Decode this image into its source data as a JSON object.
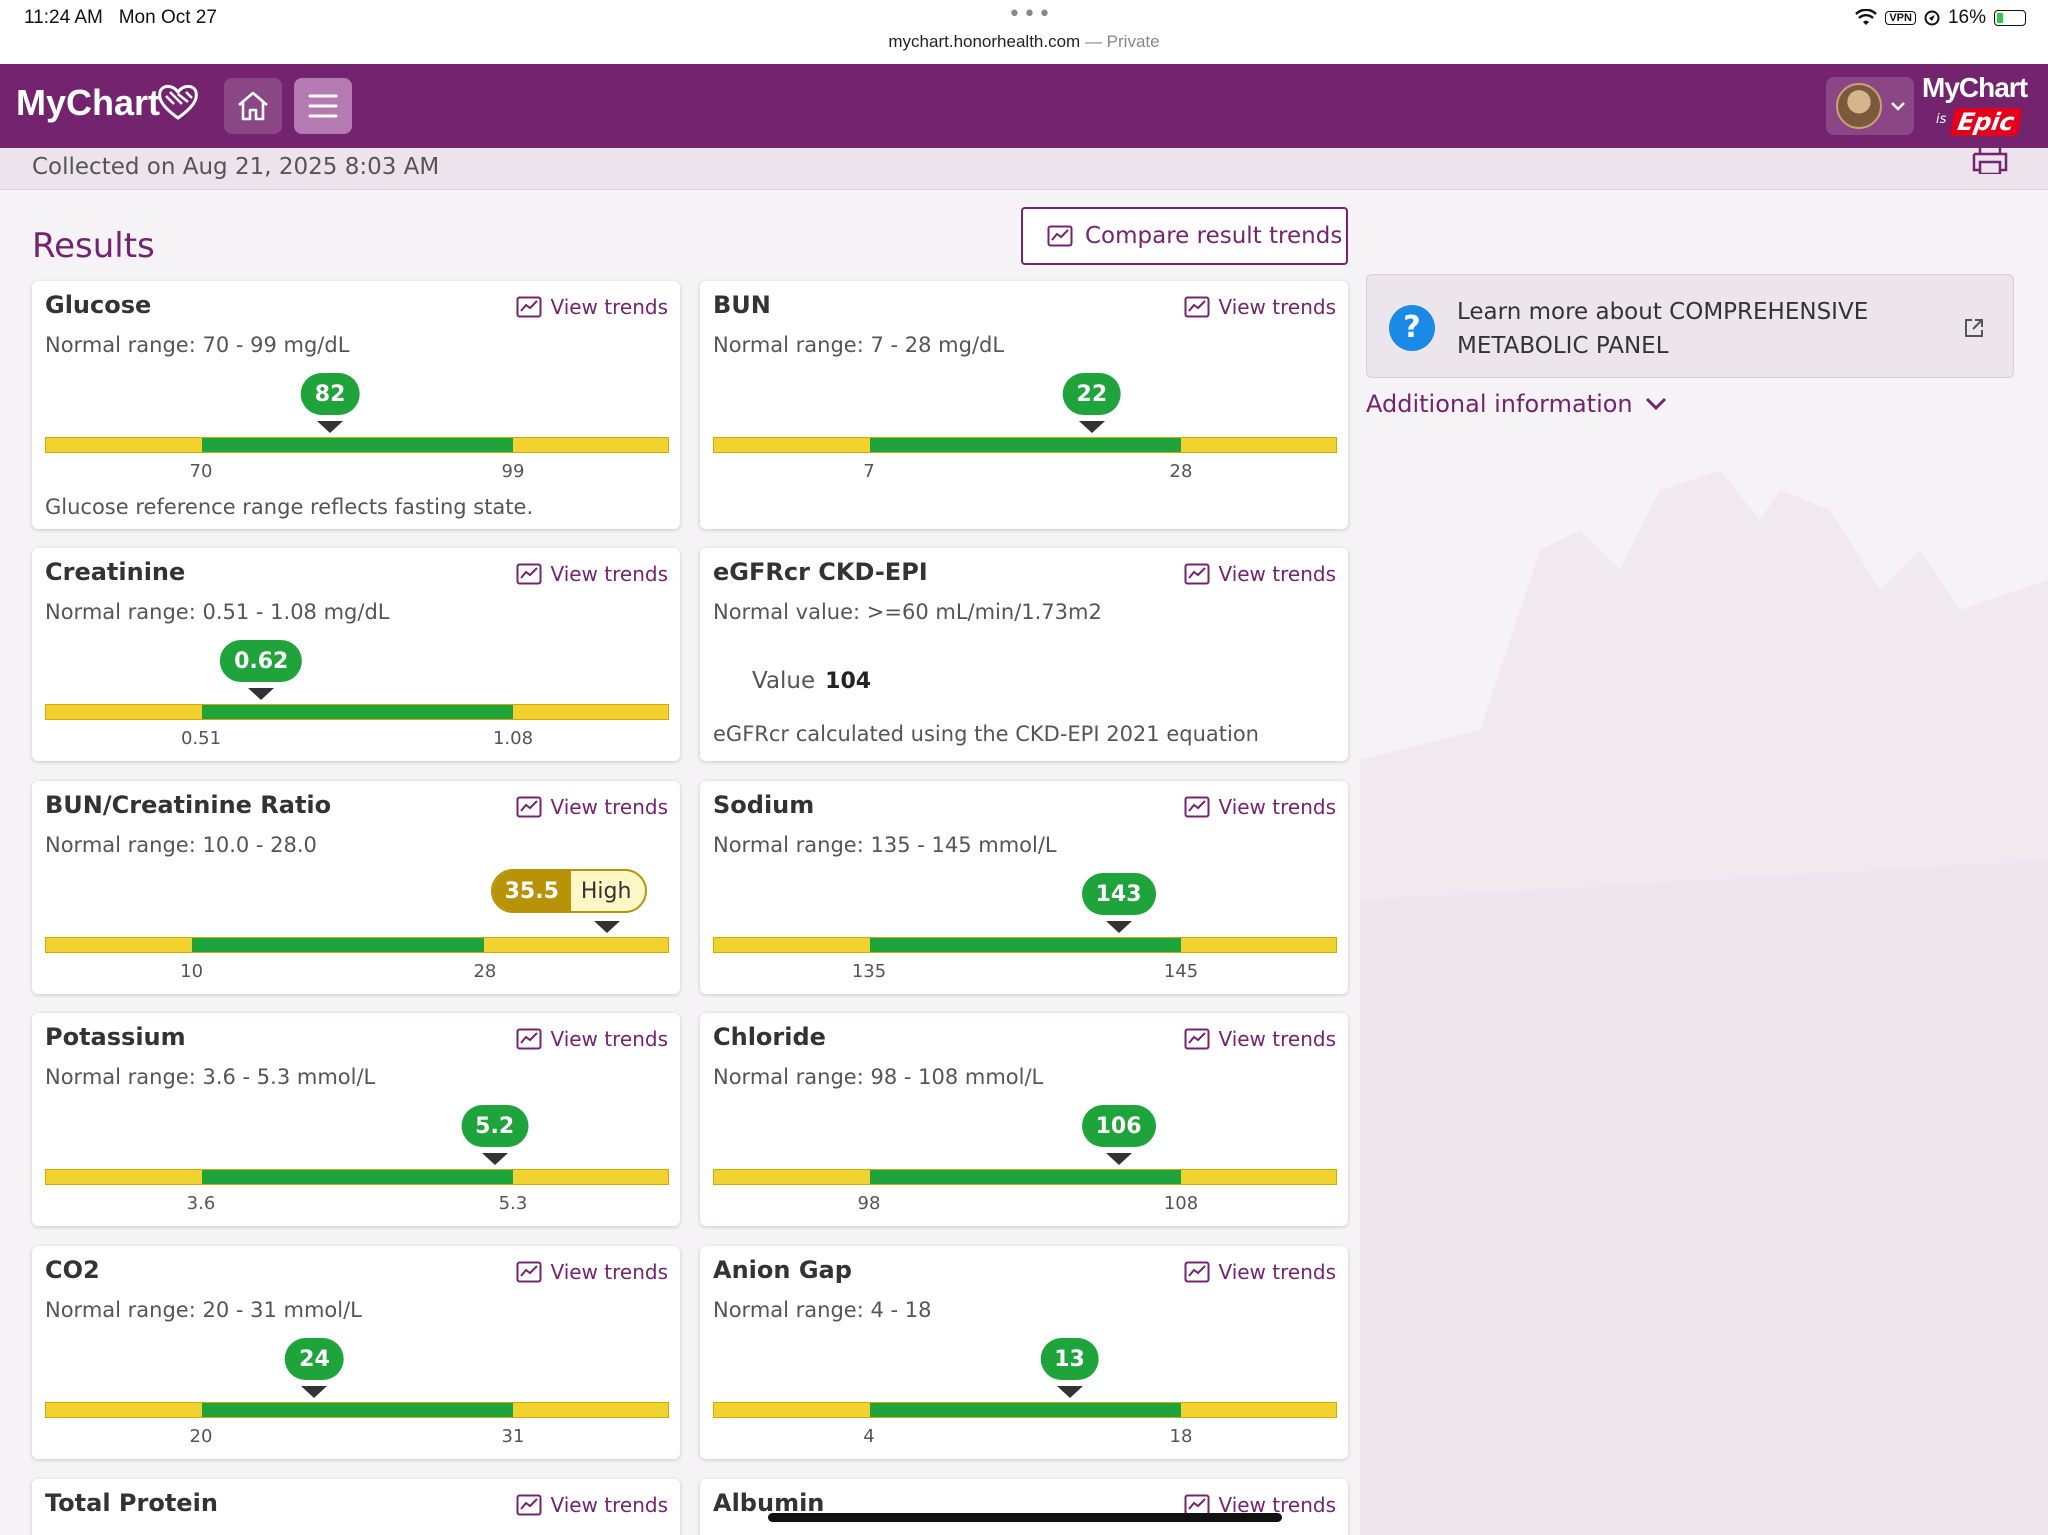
{
  "status": {
    "time": "11:24 AM",
    "date": "Mon Oct 27",
    "url": "mychart.honorhealth.com",
    "private": "— Private",
    "vpn": "VPN",
    "battery": "16%"
  },
  "header": {
    "logo_text": "MyChart",
    "epic_mychart": "MyChart",
    "epic_is": "is",
    "epic_brand": "Epic"
  },
  "collected": "Collected on Aug 21, 2025 8:03 AM",
  "results_title": "Results",
  "compare_label": "Compare result trends",
  "view_trends": "View trends",
  "learn_more": "Learn more about COMPREHENSIVE METABOLIC PANEL",
  "additional_info": "Additional information",
  "results": [
    {
      "name": "Glucose",
      "range_text": "Normal range: 70 - 99 mg/dL",
      "value": "82",
      "low": "70",
      "high": "99",
      "note": "Glucose reference range reflects fasting state."
    },
    {
      "name": "BUN",
      "range_text": "Normal range: 7 - 28 mg/dL",
      "value": "22",
      "low": "7",
      "high": "28"
    },
    {
      "name": "Creatinine",
      "range_text": "Normal range: 0.51 - 1.08 mg/dL",
      "value": "0.62",
      "low": "0.51",
      "high": "1.08"
    },
    {
      "name": "eGFRcr CKD-EPI",
      "range_text": "Normal value: >=60 mL/min/1.73m2",
      "value_label": "Value",
      "value": "104",
      "note": "eGFRcr calculated using the CKD-EPI 2021 equation"
    },
    {
      "name": "BUN/Creatinine Ratio",
      "range_text": "Normal range: 10.0 - 28.0",
      "value": "35.5",
      "flag": "High",
      "low": "10",
      "high": "28"
    },
    {
      "name": "Sodium",
      "range_text": "Normal range: 135 - 145 mmol/L",
      "value": "143",
      "low": "135",
      "high": "145"
    },
    {
      "name": "Potassium",
      "range_text": "Normal range: 3.6 - 5.3 mmol/L",
      "value": "5.2",
      "low": "3.6",
      "high": "5.3"
    },
    {
      "name": "Chloride",
      "range_text": "Normal range: 98 - 108 mmol/L",
      "value": "106",
      "low": "98",
      "high": "108"
    },
    {
      "name": "CO2",
      "range_text": "Normal range: 20 - 31 mmol/L",
      "value": "24",
      "low": "20",
      "high": "31"
    },
    {
      "name": "Anion Gap",
      "range_text": "Normal range: 4 - 18",
      "value": "13",
      "low": "4",
      "high": "18"
    },
    {
      "name": "Total Protein"
    },
    {
      "name": "Albumin"
    }
  ],
  "colors": {
    "brand": "#74246f",
    "normal": "#1ea43a",
    "out_of_range": "#f2d22e",
    "flag_high": "#b8930a"
  }
}
